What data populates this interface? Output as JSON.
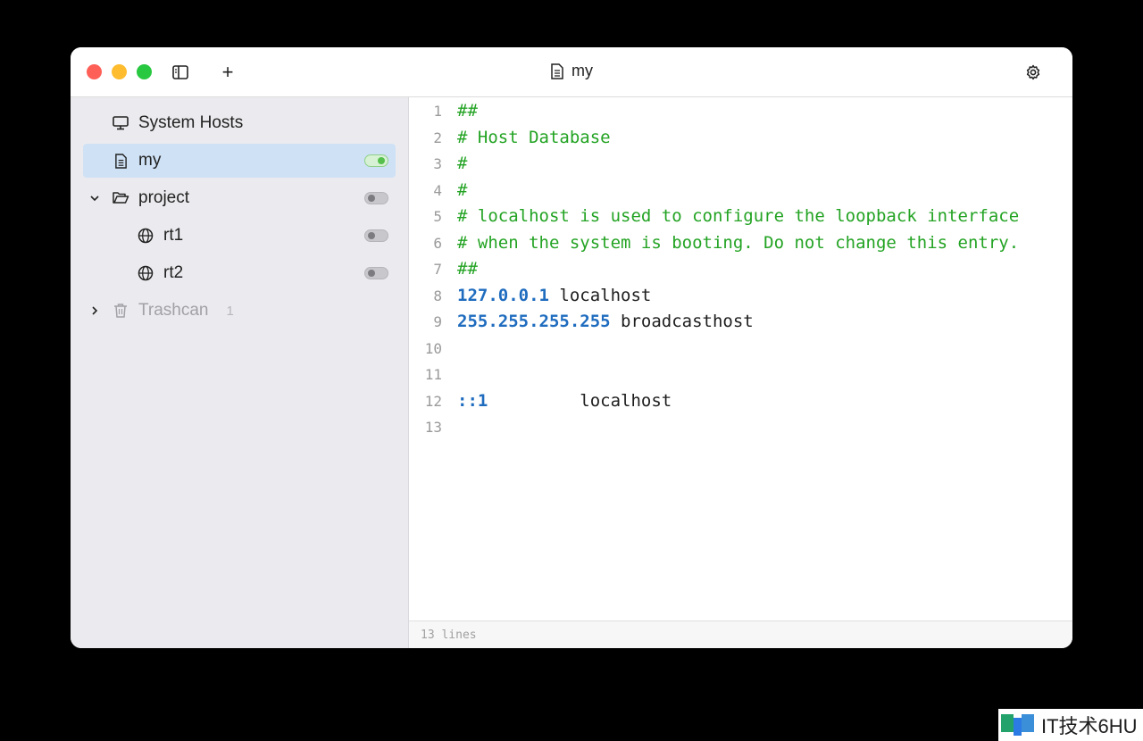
{
  "window": {
    "title": "my",
    "title_icon": "document-icon"
  },
  "toolbar": {
    "sidebar_toggle_icon": "sidebar-icon",
    "add_label": "+",
    "settings_icon": "gear-icon"
  },
  "sidebar": {
    "items": [
      {
        "label": "System Hosts",
        "icon": "monitor-icon"
      },
      {
        "label": "my",
        "icon": "document-icon",
        "enabled": true,
        "selected": true
      },
      {
        "label": "project",
        "icon": "folder-open-icon",
        "enabled": false,
        "expanded": true
      },
      {
        "label": "rt1",
        "icon": "globe-icon",
        "enabled": false
      },
      {
        "label": "rt2",
        "icon": "globe-icon",
        "enabled": false
      }
    ],
    "trash": {
      "label": "Trashcan",
      "count": "1",
      "icon": "trash-icon"
    }
  },
  "editor": {
    "lines": [
      {
        "n": "1",
        "text": "##"
      },
      {
        "n": "2",
        "text": "# Host Database"
      },
      {
        "n": "3",
        "text": "#"
      },
      {
        "n": "4",
        "text": "#"
      },
      {
        "n": "5",
        "text": "# localhost is used to configure the loopback interface"
      },
      {
        "n": "6",
        "text": "# when the system is booting. Do not change this entry."
      },
      {
        "n": "7",
        "text": "##"
      },
      {
        "n": "8",
        "ip": "127.0.0.1",
        "host": " localhost"
      },
      {
        "n": "9",
        "ip": "255.255.255.255",
        "host": " broadcasthost"
      },
      {
        "n": "10",
        "text": ""
      },
      {
        "n": "11",
        "text": ""
      },
      {
        "n": "12",
        "ip": "::1",
        "host": "         localhost"
      },
      {
        "n": "13",
        "text": ""
      }
    ],
    "status": "13 lines"
  },
  "watermark": {
    "text": "IT技术6HU"
  },
  "colors": {
    "comment": "#23a323",
    "ip": "#1f6cbf",
    "selection": "#cfe1f5",
    "toggle_on": "#56c04d"
  }
}
